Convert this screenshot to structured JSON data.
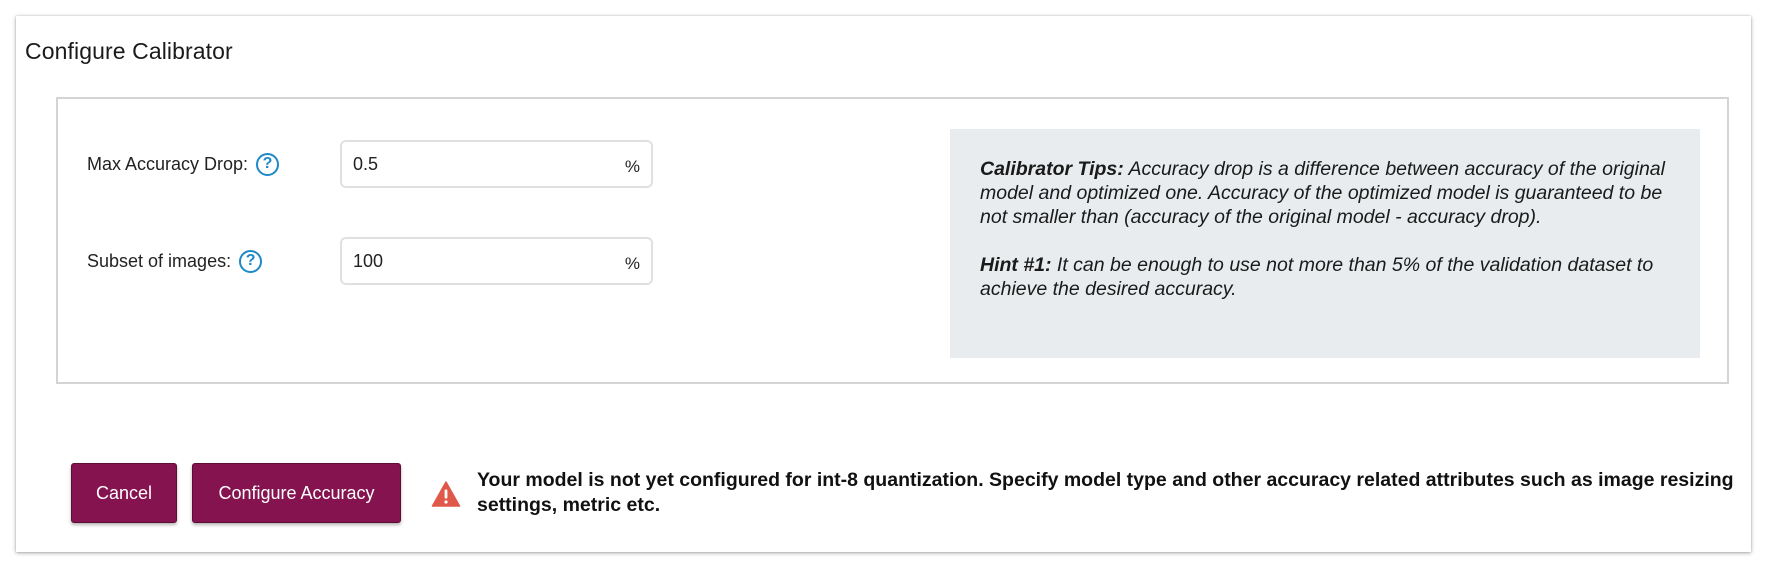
{
  "dialog": {
    "title": "Configure Calibrator"
  },
  "form": {
    "max_accuracy_drop": {
      "label": "Max Accuracy Drop:",
      "value": "0.5",
      "unit": "%",
      "help_glyph": "?"
    },
    "subset_of_images": {
      "label": "Subset of images:",
      "value": "100",
      "unit": "%",
      "help_glyph": "?"
    }
  },
  "tips": {
    "calibrator_title": "Calibrator Tips:",
    "calibrator_text": " Accuracy drop is a difference between accuracy of the original model and optimized one. Accuracy of the optimized model is guaranteed to be not smaller than (accuracy of the original model - accuracy drop).",
    "hint_title": "Hint #1:",
    "hint_text": " It can be enough to use not more than 5% of the validation dataset to achieve the desired accuracy."
  },
  "actions": {
    "cancel_label": "Cancel",
    "configure_label": "Configure Accuracy"
  },
  "warning": {
    "icon": "warning-triangle-icon",
    "text": "Your model is not yet configured for int-8 quantization. Specify model type and other accuracy related attributes such as image resizing settings, metric etc."
  },
  "colors": {
    "primary_button": "#85134f",
    "help_icon": "#1e88c8",
    "warning_icon": "#e0584a",
    "tips_background": "#e8ecee"
  }
}
